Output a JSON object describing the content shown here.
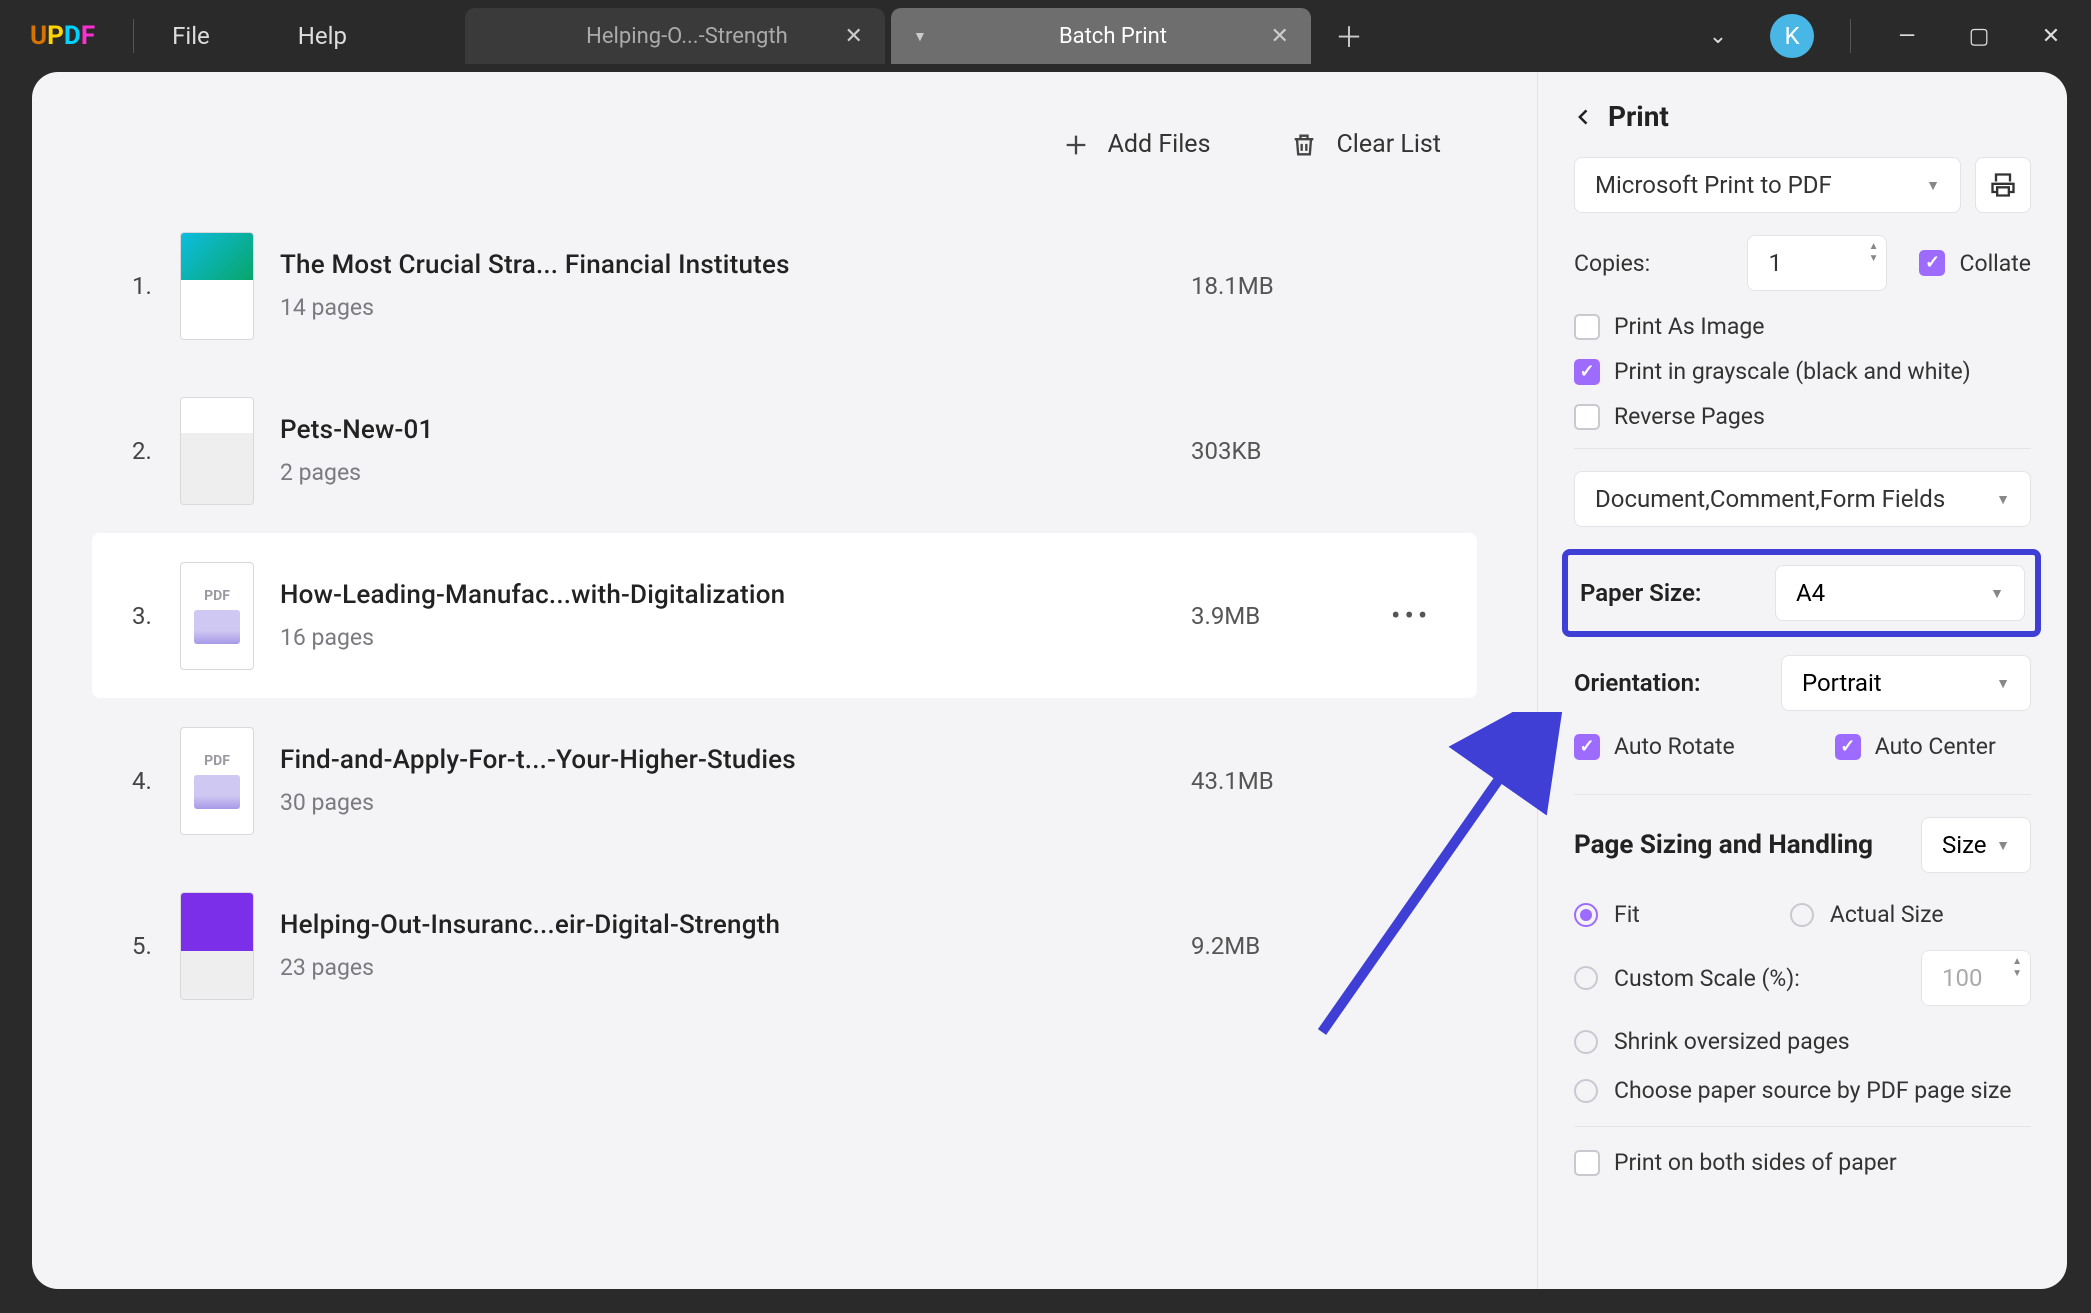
{
  "titlebar": {
    "logo": "UPDF",
    "menu_file": "File",
    "menu_help": "Help",
    "tab_inactive": "Helping-O...-Strength",
    "tab_active": "Batch Print",
    "avatar_initial": "K"
  },
  "toolbar": {
    "add_files": "Add Files",
    "clear_list": "Clear List"
  },
  "files": [
    {
      "idx": "1.",
      "title": "The Most Crucial Stra... Financial Institutes",
      "pages": "14 pages",
      "size": "18.1MB",
      "thumb": "green"
    },
    {
      "idx": "2.",
      "title": "Pets-New-01",
      "pages": "2 pages",
      "size": "303KB",
      "thumb": "article"
    },
    {
      "idx": "3.",
      "title": "How-Leading-Manufac...with-Digitalization",
      "pages": "16 pages",
      "size": "3.9MB",
      "thumb": "pdf",
      "hover": true
    },
    {
      "idx": "4.",
      "title": "Find-and-Apply-For-t...-Your-Higher-Studies",
      "pages": "30 pages",
      "size": "43.1MB",
      "thumb": "pdf"
    },
    {
      "idx": "5.",
      "title": "Helping-Out-Insuranc...eir-Digital-Strength",
      "pages": "23 pages",
      "size": "9.2MB",
      "thumb": "purple"
    }
  ],
  "side": {
    "title": "Print",
    "printer": "Microsoft Print to PDF",
    "copies_label": "Copies:",
    "copies_value": "1",
    "collate": "Collate",
    "print_as_image": "Print As Image",
    "grayscale": "Print in grayscale (black and white)",
    "reverse": "Reverse Pages",
    "content_select": "Document,Comment,Form Fields",
    "paper_size_label": "Paper Size:",
    "paper_size_value": "A4",
    "orientation_label": "Orientation:",
    "orientation_value": "Portrait",
    "auto_rotate": "Auto Rotate",
    "auto_center": "Auto Center",
    "sizing_title": "Page Sizing and Handling",
    "sizing_mode": "Size",
    "fit": "Fit",
    "actual": "Actual Size",
    "custom_scale": "Custom Scale (%):",
    "custom_scale_value": "100",
    "shrink": "Shrink oversized pages",
    "choose_source": "Choose paper source by PDF page size",
    "both_sides": "Print on both sides of paper"
  }
}
